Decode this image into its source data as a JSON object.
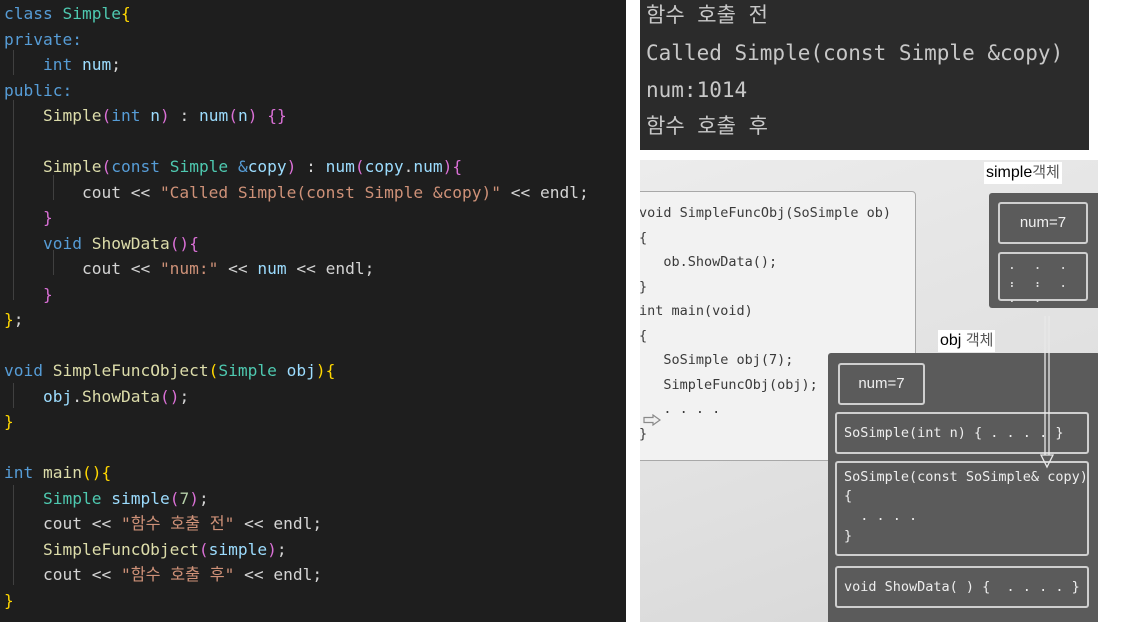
{
  "editor": {
    "lines": [
      [
        [
          "class ",
          "kw"
        ],
        [
          "Simple",
          "ty"
        ],
        [
          "{",
          "p1"
        ]
      ],
      [
        [
          "private:",
          "kw"
        ]
      ],
      [
        [
          "    ",
          ""
        ],
        [
          "int ",
          "kw"
        ],
        [
          "num",
          "vr"
        ],
        [
          ";",
          ""
        ]
      ],
      [
        [
          "public:",
          "kw"
        ]
      ],
      [
        [
          "    ",
          ""
        ],
        [
          "Simple",
          "fn"
        ],
        [
          "(",
          "p2"
        ],
        [
          "int ",
          "kw"
        ],
        [
          "n",
          "vr"
        ],
        [
          ")",
          "p2"
        ],
        [
          " : ",
          ""
        ],
        [
          "num",
          "vr"
        ],
        [
          "(",
          "p2"
        ],
        [
          "n",
          "vr"
        ],
        [
          ")",
          "p2"
        ],
        [
          " ",
          ""
        ],
        [
          "{}",
          "p2"
        ]
      ],
      [],
      [
        [
          "    ",
          ""
        ],
        [
          "Simple",
          "fn"
        ],
        [
          "(",
          "p2"
        ],
        [
          "const ",
          "kw"
        ],
        [
          "Simple ",
          "ty"
        ],
        [
          "&",
          "kw"
        ],
        [
          "copy",
          "vr"
        ],
        [
          ")",
          "p2"
        ],
        [
          " : ",
          ""
        ],
        [
          "num",
          "vr"
        ],
        [
          "(",
          "p2"
        ],
        [
          "copy",
          "vr"
        ],
        [
          ".",
          ""
        ],
        [
          "num",
          "vr"
        ],
        [
          ")",
          "p2"
        ],
        [
          "{",
          "p2"
        ]
      ],
      [
        [
          "        ",
          ""
        ],
        [
          "cout << ",
          ""
        ],
        [
          "\"Called Simple(const Simple &copy)\"",
          "st"
        ],
        [
          " << endl;",
          ""
        ]
      ],
      [
        [
          "    ",
          ""
        ],
        [
          "}",
          "p2"
        ]
      ],
      [
        [
          "    ",
          ""
        ],
        [
          "void ",
          "kw"
        ],
        [
          "ShowData",
          "fn"
        ],
        [
          "()",
          "p2"
        ],
        [
          "{",
          "p2"
        ]
      ],
      [
        [
          "        ",
          ""
        ],
        [
          "cout << ",
          ""
        ],
        [
          "\"num:\"",
          "st"
        ],
        [
          " << ",
          ""
        ],
        [
          "num",
          "vr"
        ],
        [
          " << endl;",
          ""
        ]
      ],
      [
        [
          "    ",
          ""
        ],
        [
          "}",
          "p2"
        ]
      ],
      [
        [
          "}",
          "p1"
        ],
        [
          ";",
          ""
        ]
      ],
      [],
      [
        [
          "void ",
          "kw"
        ],
        [
          "SimpleFuncObject",
          "fn"
        ],
        [
          "(",
          "p1"
        ],
        [
          "Simple ",
          "ty"
        ],
        [
          "obj",
          "vr"
        ],
        [
          ")",
          "p1"
        ],
        [
          "{",
          "p1"
        ]
      ],
      [
        [
          "    ",
          ""
        ],
        [
          "obj",
          "vr"
        ],
        [
          ".",
          ""
        ],
        [
          "ShowData",
          "fn"
        ],
        [
          "()",
          "p2"
        ],
        [
          ";",
          ""
        ]
      ],
      [
        [
          "}",
          "p1"
        ]
      ],
      [],
      [
        [
          "int ",
          "kw"
        ],
        [
          "main",
          "fn"
        ],
        [
          "()",
          "p1"
        ],
        [
          "{",
          "p1"
        ]
      ],
      [
        [
          "    ",
          ""
        ],
        [
          "Simple ",
          "ty"
        ],
        [
          "simple",
          "vr"
        ],
        [
          "(",
          "p2"
        ],
        [
          "7",
          "nm"
        ],
        [
          ")",
          "p2"
        ],
        [
          ";",
          ""
        ]
      ],
      [
        [
          "    ",
          ""
        ],
        [
          "cout << ",
          ""
        ],
        [
          "\"함수 호출 전\"",
          "st"
        ],
        [
          " << endl;",
          ""
        ]
      ],
      [
        [
          "    ",
          ""
        ],
        [
          "SimpleFuncObject",
          "fn"
        ],
        [
          "(",
          "p2"
        ],
        [
          "simple",
          "vr"
        ],
        [
          ")",
          "p2"
        ],
        [
          ";",
          ""
        ]
      ],
      [
        [
          "    ",
          ""
        ],
        [
          "cout << ",
          ""
        ],
        [
          "\"함수 호출 후\"",
          "st"
        ],
        [
          " << endl;",
          ""
        ]
      ],
      [
        [
          "}",
          "p1"
        ]
      ]
    ]
  },
  "console": {
    "lines": [
      "함수 호출 전",
      "Called Simple(const Simple &copy)",
      "num:1014",
      "함수 호출 후"
    ]
  },
  "book": {
    "code_lines": [
      "void SimpleFuncObj(SoSimple ob)",
      "{",
      "   ob.ShowData();",
      "}",
      "int main(void)",
      "{",
      "   SoSimple obj(7);",
      "   SimpleFuncObj(obj);",
      "   . . . .",
      "}"
    ],
    "simple_label": "simple",
    "simple_suffix": "객체",
    "simple_num": "num=7",
    "obj_label": "obj",
    "obj_suffix": "객체",
    "obj_num": "num=7",
    "ctor": "SoSimple(int n) { . . . . }",
    "copy_ctor_head": "SoSimple(const SoSimple& copy)",
    "copy_ctor_open": "{",
    "copy_ctor_dots": "  . . . .",
    "copy_ctor_close": "}",
    "show_data": "void ShowData( ) {  . . . . }",
    "member_dots_row": ". . . . ."
  },
  "colors": {
    "editor_bg": "#1e1e1e",
    "keyword": "#569cd6",
    "type": "#4ec9b0",
    "function": "#dcdcaa",
    "variable": "#9cdcfe",
    "string": "#ce9178",
    "number": "#b5cea8",
    "bracket_gold": "#ffd700",
    "bracket_pink": "#da70d6",
    "console_bg": "#2b2b2b",
    "object_box": "#5b5b5b"
  },
  "icons": {
    "call_pointer": "arrow-right-icon",
    "copy_flow": "arrow-down-icon"
  }
}
